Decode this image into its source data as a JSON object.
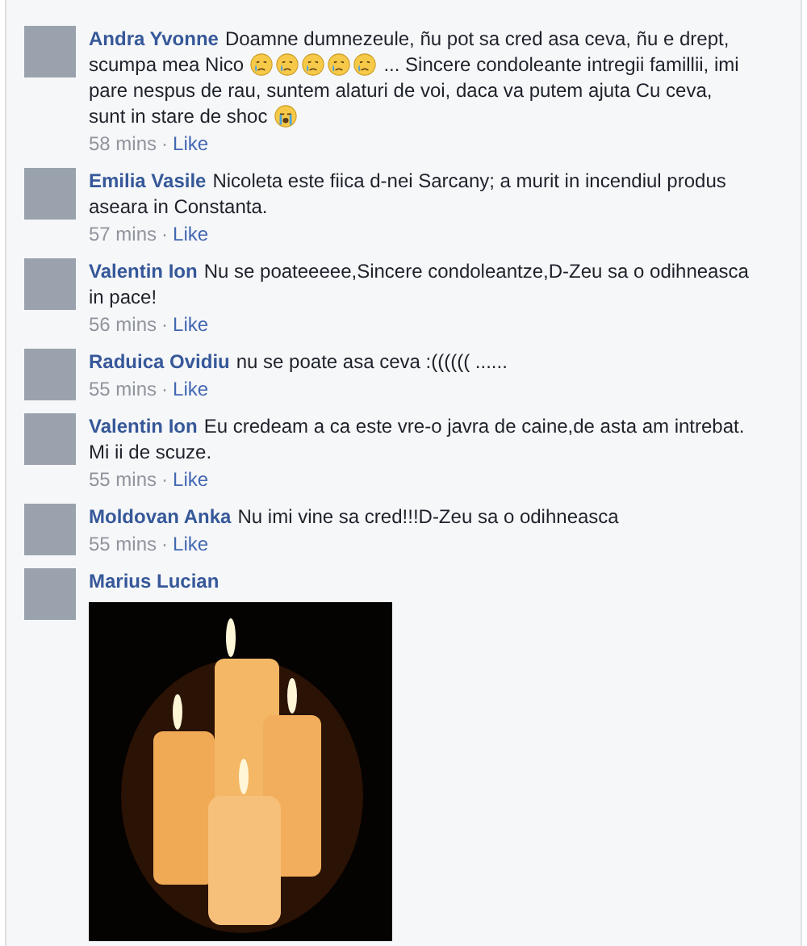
{
  "comments": [
    {
      "author": "Andra Yvonne",
      "parts": [
        {
          "kind": "text",
          "text": "Doamne dumnezeule, ñu pot sa cred asa ceva, ñu e drept, scumpa mea Nico "
        },
        {
          "kind": "cry"
        },
        {
          "kind": "cry"
        },
        {
          "kind": "cry"
        },
        {
          "kind": "cry"
        },
        {
          "kind": "cry"
        },
        {
          "kind": "text",
          "text": " ... Sincere condoleante intregii famillii, imi pare nespus de rau, suntem alaturi de voi, daca va putem ajuta Cu ceva, sunt in stare de shoc "
        },
        {
          "kind": "sob"
        }
      ],
      "time": "58 mins",
      "separator": "·",
      "like": "Like"
    },
    {
      "author": "Emilia Vasile",
      "parts": [
        {
          "kind": "text",
          "text": "Nicoleta este fiica d-nei Sarcany; a murit in incendiul produs aseara in Constanta."
        }
      ],
      "time": "57 mins",
      "separator": "·",
      "like": "Like"
    },
    {
      "author": "Valentin Ion",
      "parts": [
        {
          "kind": "text",
          "text": "Nu se poateeeee,Sincere condoleantze,D-Zeu sa o odihneasca in pace!"
        }
      ],
      "time": "56 mins",
      "separator": "·",
      "like": "Like"
    },
    {
      "author": "Raduica Ovidiu",
      "parts": [
        {
          "kind": "text",
          "text": "nu se poate asa ceva :(((((( ......"
        }
      ],
      "time": "55 mins",
      "separator": "·",
      "like": "Like"
    },
    {
      "author": "Valentin Ion",
      "parts": [
        {
          "kind": "text",
          "text": "Eu credeam a ca este vre-o javra de caine,de asta am intrebat. Mi ii de scuze."
        }
      ],
      "time": "55 mins",
      "separator": "·",
      "like": "Like"
    },
    {
      "author": "Moldovan Anka",
      "parts": [
        {
          "kind": "text",
          "text": "Nu imi vine sa cred!!!D-Zeu sa o odihneasca"
        }
      ],
      "time": "55 mins",
      "separator": "·",
      "like": "Like"
    },
    {
      "author": "Marius Lucian",
      "parts": [
        {
          "kind": "photo"
        }
      ]
    }
  ]
}
